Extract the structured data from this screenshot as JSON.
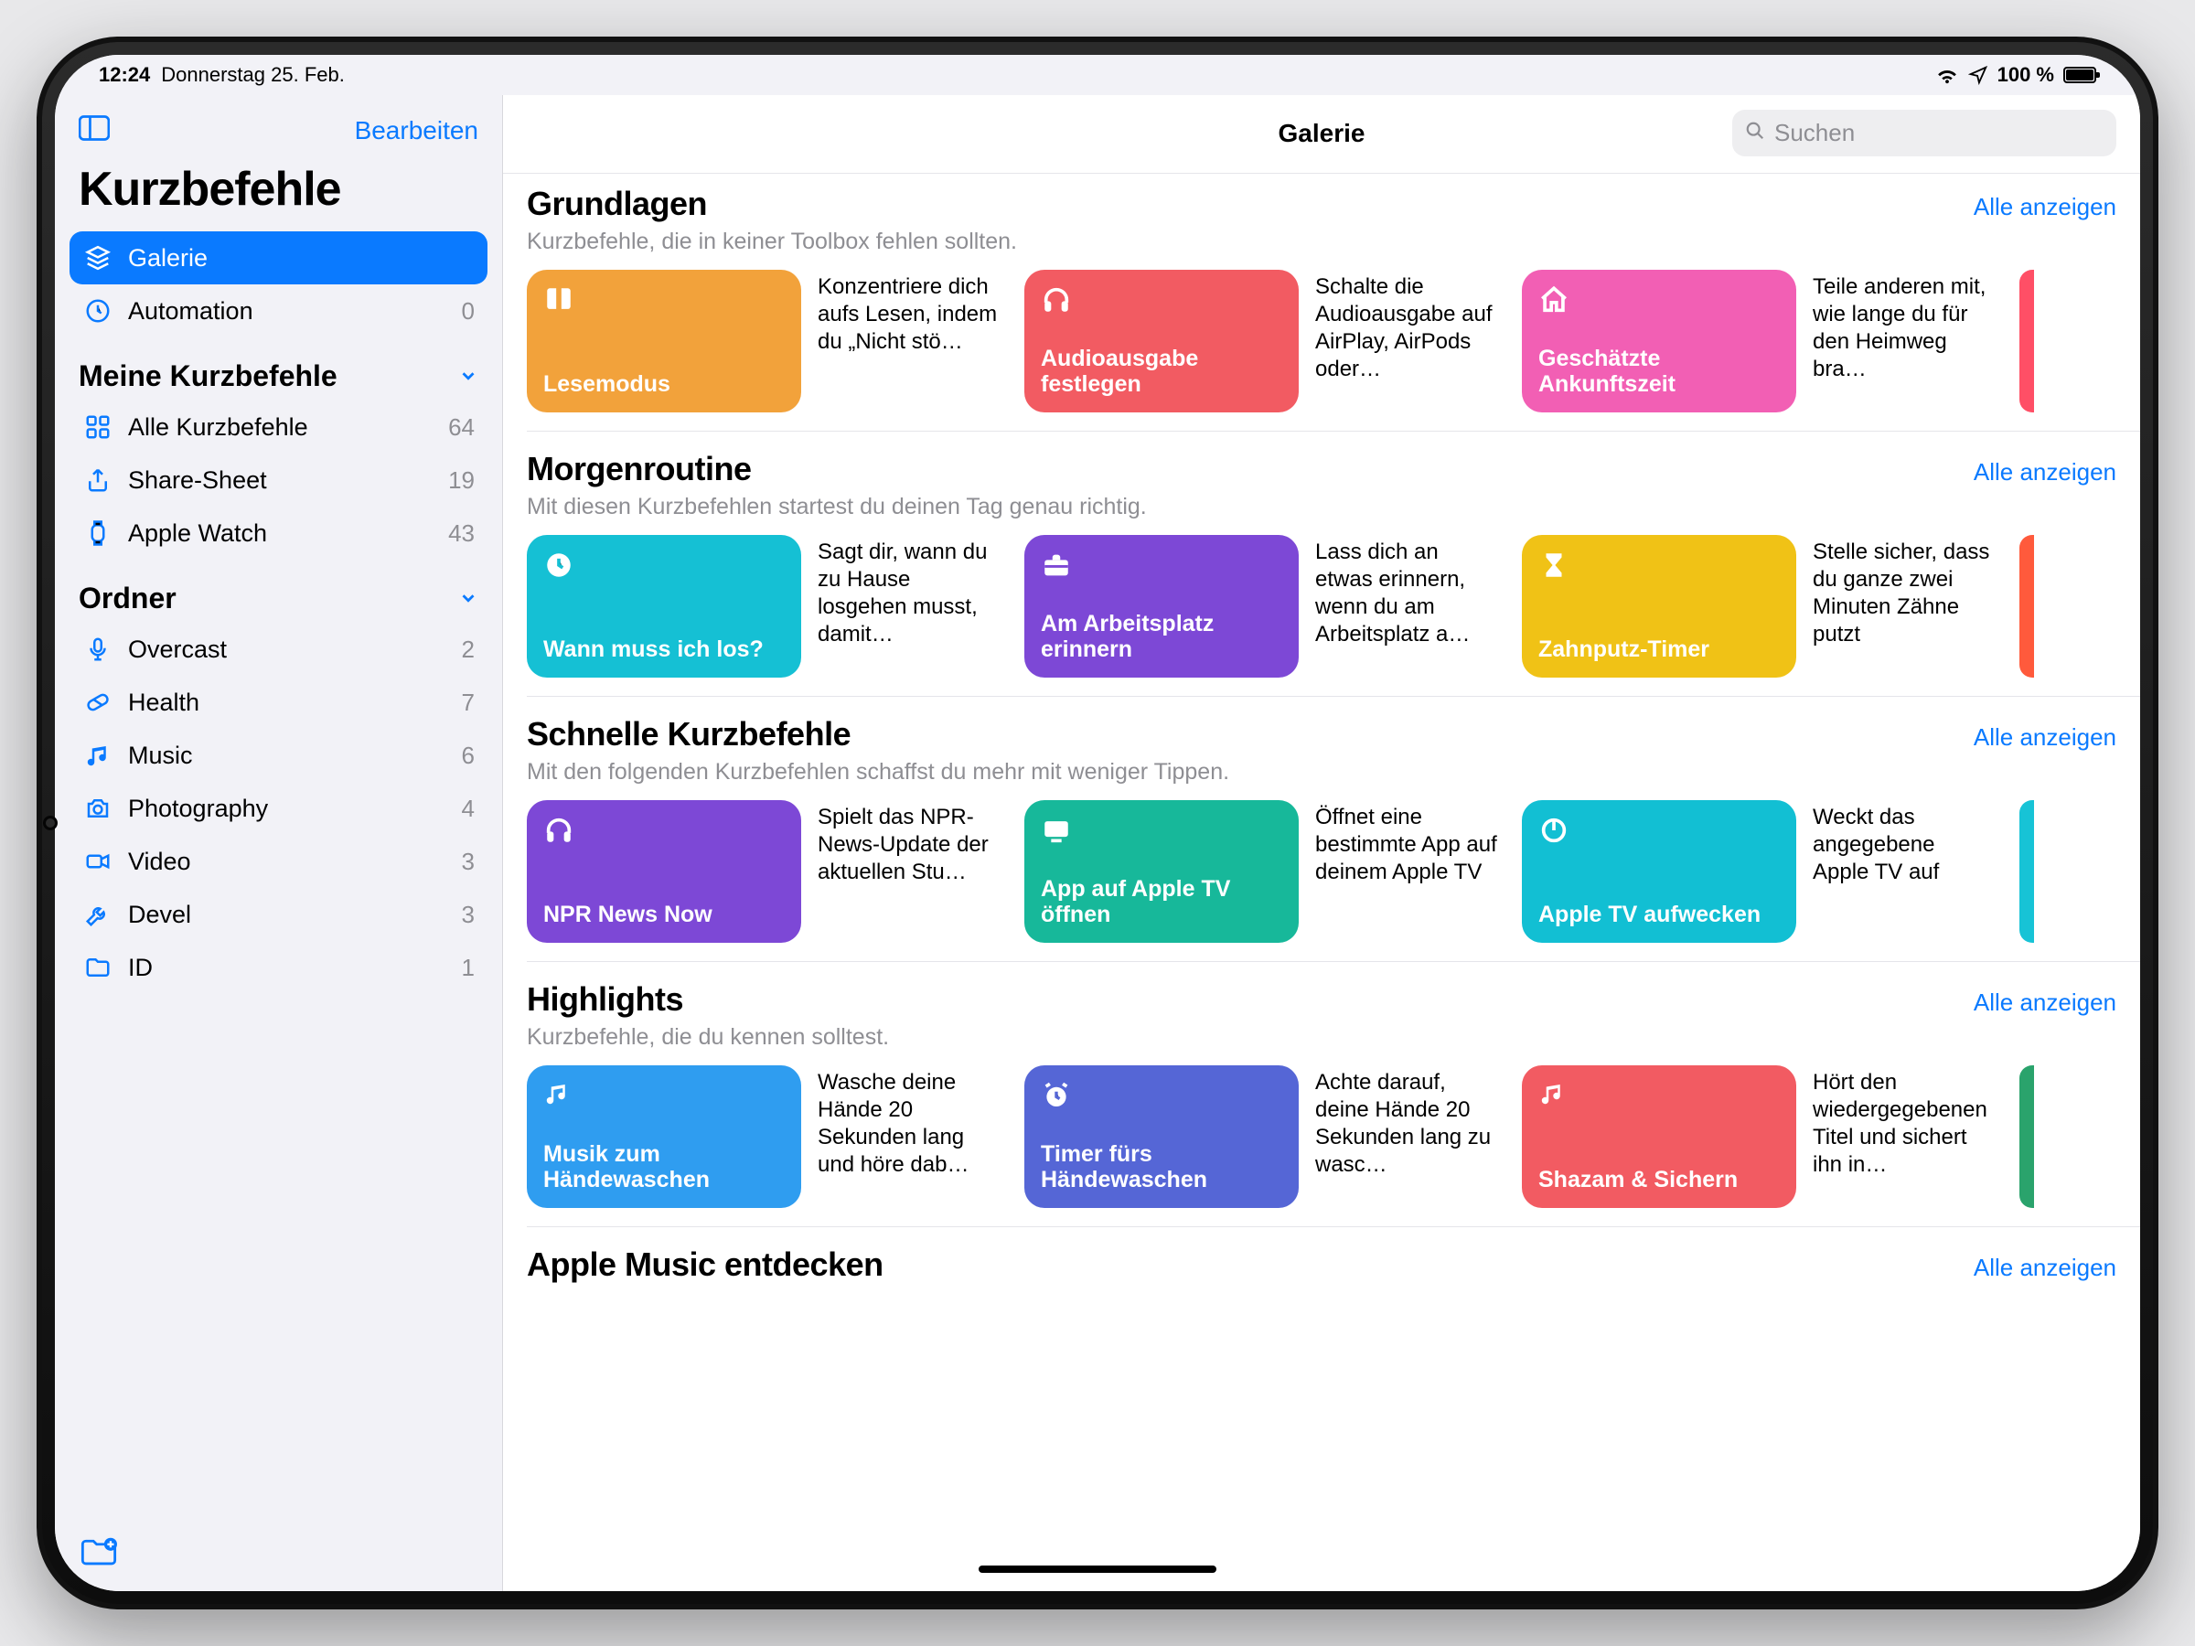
{
  "status": {
    "time": "12:24",
    "date": "Donnerstag 25. Feb.",
    "battery": "100 %"
  },
  "sidebar": {
    "edit": "Bearbeiten",
    "title": "Kurzbefehle",
    "primary": [
      {
        "icon": "gallery",
        "label": "Galerie",
        "count": ""
      },
      {
        "icon": "clock",
        "label": "Automation",
        "count": "0"
      }
    ],
    "sections": [
      {
        "title": "Meine Kurzbefehle",
        "items": [
          {
            "icon": "grid",
            "label": "Alle Kurzbefehle",
            "count": "64"
          },
          {
            "icon": "share",
            "label": "Share-Sheet",
            "count": "19"
          },
          {
            "icon": "watch",
            "label": "Apple Watch",
            "count": "43"
          }
        ]
      },
      {
        "title": "Ordner",
        "items": [
          {
            "icon": "mic",
            "label": "Overcast",
            "count": "2"
          },
          {
            "icon": "pill",
            "label": "Health",
            "count": "7"
          },
          {
            "icon": "music",
            "label": "Music",
            "count": "6"
          },
          {
            "icon": "camera",
            "label": "Photography",
            "count": "4"
          },
          {
            "icon": "video",
            "label": "Video",
            "count": "3"
          },
          {
            "icon": "wrench",
            "label": "Devel",
            "count": "3"
          },
          {
            "icon": "folder",
            "label": "ID",
            "count": "1"
          }
        ]
      }
    ]
  },
  "main": {
    "title": "Galerie",
    "search_placeholder": "Suchen",
    "show_all": "Alle anzeigen",
    "sections": [
      {
        "title": "Grundlagen",
        "subtitle": "Kurzbefehle, die in keiner Toolbox fehlen sollten.",
        "peek_color": "#ff4f66",
        "cards": [
          {
            "color": "#f2a23b",
            "icon": "book",
            "title": "Lesemodus",
            "desc": "Konzentriere dich aufs Lesen, indem du „Nicht stö…"
          },
          {
            "color": "#f25b62",
            "icon": "headphones",
            "title": "Audioausgabe festlegen",
            "desc": "Schalte die Audioausgabe auf AirPlay, AirPods oder…"
          },
          {
            "color": "#f25fb4",
            "icon": "home",
            "title": "Geschätzte Ankunftszeit",
            "desc": "Teile anderen mit, wie lange du für den Heimweg bra…"
          }
        ]
      },
      {
        "title": "Morgenroutine",
        "subtitle": "Mit diesen Kurzbefehlen startest du deinen Tag genau richtig.",
        "peek_color": "#ff5a3c",
        "cards": [
          {
            "color": "#15c0d4",
            "icon": "clock-solid",
            "title": "Wann muss ich los?",
            "desc": "Sagt dir, wann du zu Hause losgehen musst, damit…"
          },
          {
            "color": "#7d48d6",
            "icon": "briefcase",
            "title": "Am Arbeitsplatz erinnern",
            "desc": "Lass dich an etwas erinnern, wenn du am Arbeitsplatz a…"
          },
          {
            "color": "#f0c216",
            "icon": "hourglass",
            "title": "Zahnputz-Timer",
            "desc": "Stelle sicher, dass du ganze zwei Minuten Zähne putzt"
          }
        ]
      },
      {
        "title": "Schnelle Kurzbefehle",
        "subtitle": "Mit den folgenden Kurzbefehlen schaffst du mehr mit weniger Tippen.",
        "peek_color": "#17c3d6",
        "cards": [
          {
            "color": "#7d48d6",
            "icon": "headphones",
            "title": "NPR News Now",
            "desc": "Spielt das NPR-News-Update der aktuellen Stu…"
          },
          {
            "color": "#17b89a",
            "icon": "tv",
            "title": "App auf Apple TV öffnen",
            "desc": "Öffnet eine bestimmte App auf deinem Apple TV"
          },
          {
            "color": "#12bfd3",
            "icon": "power",
            "title": "Apple TV aufwecken",
            "desc": "Weckt das angegebene Apple TV auf"
          }
        ]
      },
      {
        "title": "Highlights",
        "subtitle": "Kurzbefehle, die du kennen solltest.",
        "peek_color": "#2aa36c",
        "cards": [
          {
            "color": "#2f9df0",
            "icon": "music",
            "title": "Musik zum Händewaschen",
            "desc": "Wasche deine Hände 20 Sekunden lang und höre dab…"
          },
          {
            "color": "#5566d6",
            "icon": "alarm",
            "title": "Timer fürs Händewaschen",
            "desc": "Achte darauf, deine Hände 20 Sekunden lang zu wasc…"
          },
          {
            "color": "#f25b62",
            "icon": "music",
            "title": "Shazam & Sichern",
            "desc": "Hört den wiedergegebenen Titel und sichert ihn in…"
          }
        ]
      },
      {
        "title": "Apple Music entdecken",
        "subtitle": "",
        "peek_color": "",
        "cards": []
      }
    ]
  }
}
